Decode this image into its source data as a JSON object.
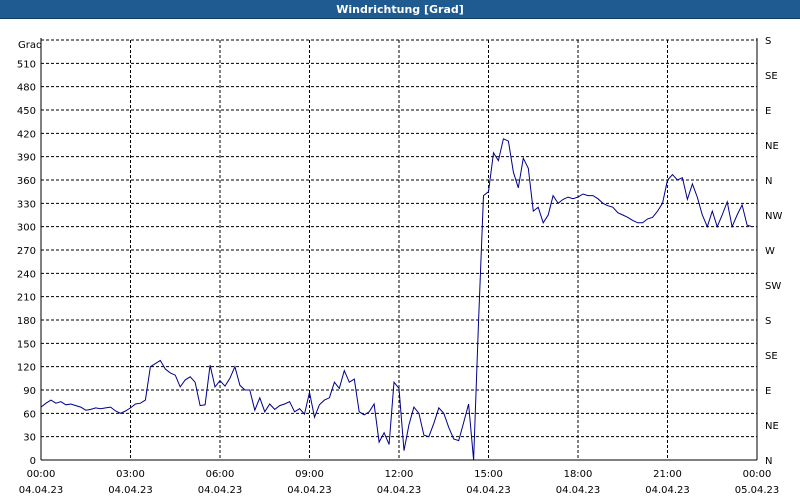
{
  "window": {
    "title": "Windrichtung [Grad]"
  },
  "chart_data": {
    "type": "line",
    "title": "Windrichtung [Grad]",
    "ylabel": "Grad",
    "ylim": [
      0,
      540
    ],
    "yticks": [
      0,
      30,
      60,
      90,
      120,
      150,
      180,
      210,
      240,
      270,
      300,
      330,
      360,
      390,
      420,
      450,
      480,
      510
    ],
    "right_axis_labels": [
      "N",
      "NE",
      "E",
      "SE",
      "S",
      "SW",
      "W",
      "NW",
      "N",
      "NE",
      "E",
      "SE",
      "S"
    ],
    "xlim": [
      "2023-04-04 00:00",
      "2023-04-05 00:00"
    ],
    "x_tick_labels": [
      {
        "time": "00:00",
        "date": "04.04.23"
      },
      {
        "time": "03:00",
        "date": "04.04.23"
      },
      {
        "time": "06:00",
        "date": "04.04.23"
      },
      {
        "time": "09:00",
        "date": "04.04.23"
      },
      {
        "time": "12:00",
        "date": "04.04.23"
      },
      {
        "time": "15:00",
        "date": "04.04.23"
      },
      {
        "time": "18:00",
        "date": "04.04.23"
      },
      {
        "time": "21:00",
        "date": "04.04.23"
      },
      {
        "time": "00:00",
        "date": "05.04.23"
      }
    ],
    "grid": true,
    "line_color": "#00008b",
    "series": [
      {
        "x": [
          "2023-04-04 00:00",
          "2023-04-04 00:10",
          "2023-04-04 00:20",
          "2023-04-04 00:30",
          "2023-04-04 00:40",
          "2023-04-04 00:50",
          "2023-04-04 01:00",
          "2023-04-04 01:10",
          "2023-04-04 01:20",
          "2023-04-04 01:30",
          "2023-04-04 01:40",
          "2023-04-04 01:50",
          "2023-04-04 02:00",
          "2023-04-04 02:10",
          "2023-04-04 02:20",
          "2023-04-04 02:30",
          "2023-04-04 02:40",
          "2023-04-04 02:50",
          "2023-04-04 03:00",
          "2023-04-04 03:10",
          "2023-04-04 03:20",
          "2023-04-04 03:30",
          "2023-04-04 03:40",
          "2023-04-04 03:50",
          "2023-04-04 04:00",
          "2023-04-04 04:10",
          "2023-04-04 04:20",
          "2023-04-04 04:30",
          "2023-04-04 04:40",
          "2023-04-04 04:50",
          "2023-04-04 05:00",
          "2023-04-04 05:10",
          "2023-04-04 05:20",
          "2023-04-04 05:30",
          "2023-04-04 05:40",
          "2023-04-04 05:50",
          "2023-04-04 06:00",
          "2023-04-04 06:10",
          "2023-04-04 06:20",
          "2023-04-04 06:30",
          "2023-04-04 06:40",
          "2023-04-04 06:50",
          "2023-04-04 07:00",
          "2023-04-04 07:10",
          "2023-04-04 07:20",
          "2023-04-04 07:30",
          "2023-04-04 07:40",
          "2023-04-04 07:50",
          "2023-04-04 08:00",
          "2023-04-04 08:10",
          "2023-04-04 08:20",
          "2023-04-04 08:30",
          "2023-04-04 08:40",
          "2023-04-04 08:50",
          "2023-04-04 09:00",
          "2023-04-04 09:10",
          "2023-04-04 09:20",
          "2023-04-04 09:30",
          "2023-04-04 09:40",
          "2023-04-04 09:50",
          "2023-04-04 10:00",
          "2023-04-04 10:10",
          "2023-04-04 10:20",
          "2023-04-04 10:30",
          "2023-04-04 10:40",
          "2023-04-04 10:50",
          "2023-04-04 11:00",
          "2023-04-04 11:10",
          "2023-04-04 11:20",
          "2023-04-04 11:30",
          "2023-04-04 11:40",
          "2023-04-04 11:50",
          "2023-04-04 12:00",
          "2023-04-04 12:10",
          "2023-04-04 12:20",
          "2023-04-04 12:30",
          "2023-04-04 12:40",
          "2023-04-04 12:50",
          "2023-04-04 13:00",
          "2023-04-04 13:10",
          "2023-04-04 13:20",
          "2023-04-04 13:30",
          "2023-04-04 13:40",
          "2023-04-04 13:50",
          "2023-04-04 14:00",
          "2023-04-04 14:10",
          "2023-04-04 14:20",
          "2023-04-04 14:30",
          "2023-04-04 14:40",
          "2023-04-04 14:50",
          "2023-04-04 15:00",
          "2023-04-04 15:10",
          "2023-04-04 15:20",
          "2023-04-04 15:30",
          "2023-04-04 15:40",
          "2023-04-04 15:50",
          "2023-04-04 16:00",
          "2023-04-04 16:10",
          "2023-04-04 16:20",
          "2023-04-04 16:30",
          "2023-04-04 16:40",
          "2023-04-04 16:50",
          "2023-04-04 17:00",
          "2023-04-04 17:10",
          "2023-04-04 17:20",
          "2023-04-04 17:30",
          "2023-04-04 17:40",
          "2023-04-04 17:50",
          "2023-04-04 18:00",
          "2023-04-04 18:10",
          "2023-04-04 18:20",
          "2023-04-04 18:30",
          "2023-04-04 18:40",
          "2023-04-04 18:50",
          "2023-04-04 19:00",
          "2023-04-04 19:10",
          "2023-04-04 19:20",
          "2023-04-04 19:30",
          "2023-04-04 19:40",
          "2023-04-04 19:50",
          "2023-04-04 20:00",
          "2023-04-04 20:10",
          "2023-04-04 20:20",
          "2023-04-04 20:30",
          "2023-04-04 20:40",
          "2023-04-04 20:50",
          "2023-04-04 21:00",
          "2023-04-04 21:10",
          "2023-04-04 21:20",
          "2023-04-04 21:30",
          "2023-04-04 21:40",
          "2023-04-04 21:50",
          "2023-04-04 22:00",
          "2023-04-04 22:10",
          "2023-04-04 22:20",
          "2023-04-04 22:30",
          "2023-04-04 22:40",
          "2023-04-04 22:50",
          "2023-04-04 23:00",
          "2023-04-04 23:10",
          "2023-04-04 23:20",
          "2023-04-04 23:30",
          "2023-04-04 23:40",
          "2023-04-04 23:50"
        ],
        "y": [
          68,
          73,
          77,
          73,
          75,
          71,
          72,
          70,
          68,
          64,
          65,
          67,
          66,
          67,
          68,
          63,
          60,
          63,
          67,
          72,
          73,
          77,
          120,
          124,
          128,
          117,
          112,
          109,
          94,
          103,
          107,
          100,
          70,
          71,
          122,
          94,
          102,
          95,
          105,
          120,
          96,
          90,
          90,
          64,
          80,
          62,
          72,
          65,
          70,
          72,
          75,
          62,
          66,
          59,
          87,
          55,
          71,
          77,
          80,
          100,
          92,
          115,
          100,
          104,
          62,
          58,
          62,
          72,
          23,
          35,
          20,
          100,
          92,
          12,
          45,
          68,
          60,
          32,
          30,
          47,
          67,
          60,
          42,
          27,
          25,
          48,
          72,
          0,
          180,
          340,
          345,
          395,
          385,
          413,
          410,
          370,
          350,
          388,
          375,
          320,
          325,
          305,
          315,
          340,
          330,
          335,
          338,
          336,
          338,
          342,
          340,
          340,
          336,
          330,
          327,
          325,
          318,
          315,
          312,
          308,
          305,
          305,
          310,
          312,
          320,
          330,
          360,
          367,
          360,
          363,
          335,
          355,
          338,
          315,
          300,
          320,
          300,
          315,
          332,
          300,
          315,
          328,
          302,
          300
        ]
      }
    ]
  }
}
